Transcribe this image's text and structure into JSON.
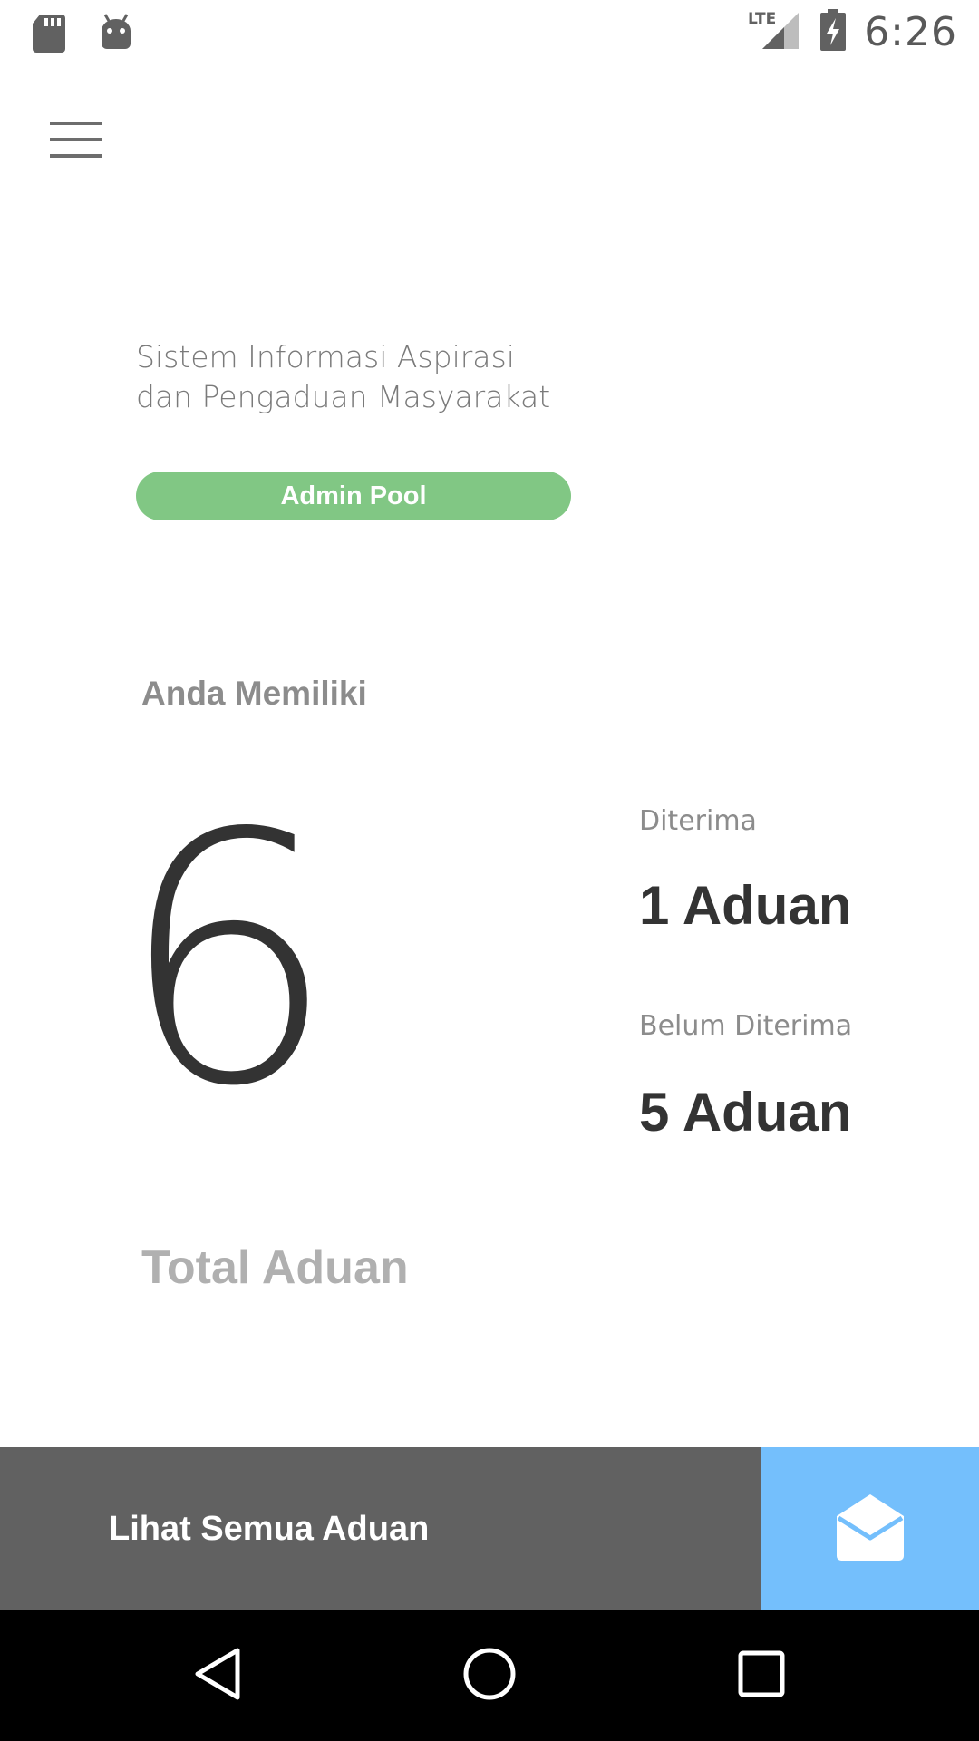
{
  "status_bar": {
    "time": "6:26",
    "network": "LTE",
    "icons": [
      "sd-card-icon",
      "android-debug-icon",
      "lte-signal-icon",
      "battery-charging-icon"
    ]
  },
  "header": {
    "menu_icon": "hamburger-menu-icon",
    "title_line1": "Sistem Informasi Aspirasi",
    "title_line2": "dan Pengaduan Masyarakat",
    "role_badge": "Admin Pool"
  },
  "summary": {
    "heading": "Anda Memiliki",
    "total": "6",
    "total_label": "Total Aduan",
    "received_label": "Diterima",
    "received_value": "1 Aduan",
    "pending_label": "Belum Diterima",
    "pending_value": "5 Aduan"
  },
  "bottom_bar": {
    "view_all_label": "Lihat Semua Aduan",
    "inbox_icon": "open-envelope-icon"
  },
  "nav_bar": {
    "icons": [
      "back-icon",
      "home-icon",
      "recents-icon"
    ]
  },
  "colors": {
    "role_badge_bg": "#81c784",
    "bottom_bar_bg": "#616161",
    "inbox_button_bg": "#74bffc",
    "primary_text": "#333333",
    "secondary_text": "#8c8c8c"
  }
}
